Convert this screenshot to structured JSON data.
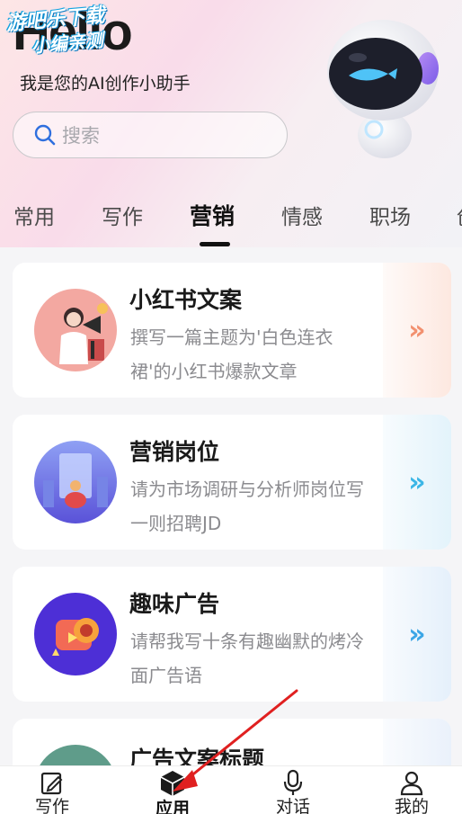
{
  "header": {
    "greeting": "Hello",
    "watermark_line1": "游吧乐下载",
    "watermark_line2": "小编亲测",
    "subtitle": "我是您的AI创作小助手",
    "search_placeholder": "搜索",
    "search_icon": "search-icon",
    "mascot": "robot-mascot"
  },
  "tabs": [
    {
      "label": "常用",
      "active": false
    },
    {
      "label": "写作",
      "active": false
    },
    {
      "label": "营销",
      "active": true
    },
    {
      "label": "情感",
      "active": false
    },
    {
      "label": "职场",
      "active": false
    },
    {
      "label": "创",
      "active": false
    }
  ],
  "cards": [
    {
      "title": "小红书文案",
      "desc": "撰写一篇主题为'白色连衣裙'的小红书爆款文章",
      "arrow": "»",
      "arrow_color": "#f2906f",
      "arrow_bg": "#fdeee8",
      "thumb_bg": "#f3a8a1"
    },
    {
      "title": "营销岗位",
      "desc": "请为市场调研与分析师岗位写一则招聘JD",
      "arrow": "»",
      "arrow_color": "#3bb6e6",
      "arrow_bg": "#e6f4fb",
      "thumb_bg": "#6f7be8"
    },
    {
      "title": "趣味广告",
      "desc": "请帮我写十条有趣幽默的烤冷面广告语",
      "arrow": "»",
      "arrow_color": "#3ba6e6",
      "arrow_bg": "#e8f2fb",
      "thumb_bg": "#4d2fd6"
    },
    {
      "title": "广告文案标题",
      "desc": "",
      "arrow": "»",
      "arrow_color": "#3ba6e6",
      "arrow_bg": "#eef4fb",
      "thumb_bg": "#5f9c8a"
    }
  ],
  "bottom_nav": [
    {
      "label": "写作",
      "icon": "edit-icon",
      "active": false
    },
    {
      "label": "应用",
      "icon": "cube-icon",
      "active": true
    },
    {
      "label": "对话",
      "icon": "microphone-icon",
      "active": false
    },
    {
      "label": "我的",
      "icon": "user-icon",
      "active": false
    }
  ],
  "annotation_color": "#e02020"
}
